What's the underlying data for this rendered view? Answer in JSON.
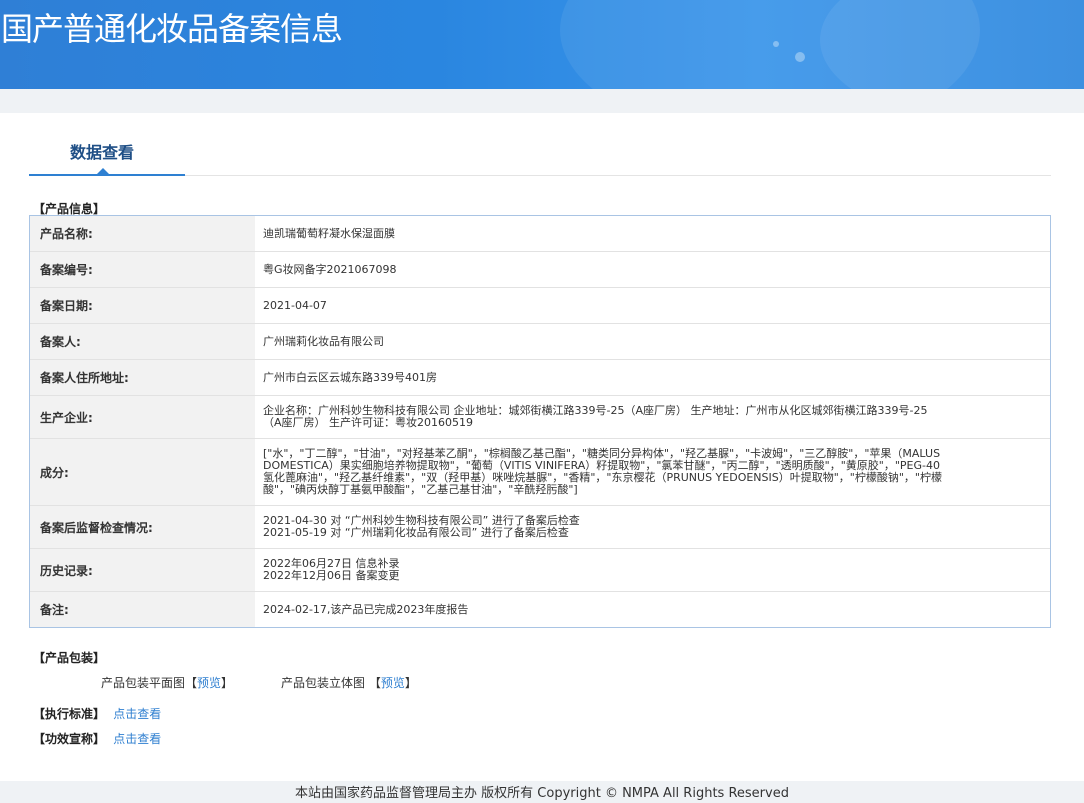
{
  "header": {
    "title": "国产普通化妆品备案信息"
  },
  "tab": {
    "label": "数据查看"
  },
  "sections": {
    "product_info": "【产品信息】",
    "product_package": "【产品包装】",
    "exec_standard": "【执行标准】",
    "efficacy_claim": "【功效宣称】"
  },
  "rows": [
    {
      "label": "产品名称:",
      "value": "迪凯瑞葡萄籽凝水保湿面膜"
    },
    {
      "label": "备案编号:",
      "value": "粤G妆网备字2021067098"
    },
    {
      "label": "备案日期:",
      "value": "2021-04-07"
    },
    {
      "label": "备案人:",
      "value": "广州瑞莉化妆品有限公司"
    },
    {
      "label": "备案人住所地址:",
      "value": "广州市白云区云城东路339号401房"
    },
    {
      "label": "生产企业:",
      "lines": [
        "企业名称：广州科妙生物科技有限公司 企业地址：城郊街横江路339号-25（A座厂房） 生产地址：广州市从化区城郊街横江路339号-25",
        "（A座厂房） 生产许可证：粤妆20160519"
      ]
    },
    {
      "label": "成分:",
      "lines": [
        "[\"水\"，\"丁二醇\"，\"甘油\"，\"对羟基苯乙酮\"，\"棕榈酸乙基己酯\"，\"糖类同分异构体\"，\"羟乙基脲\"，\"卡波姆\"，\"三乙醇胺\"，\"苹果（MALUS",
        "DOMESTICA）果实细胞培养物提取物\"，\"葡萄（VITIS VINIFERA）籽提取物\"，\"氯苯甘醚\"，\"丙二醇\"，\"透明质酸\"，\"黄原胶\"，\"PEG-40",
        "氢化蓖麻油\"，\"羟乙基纤维素\"，\"双（羟甲基）咪唑烷基脲\"，\"香精\"，\"东京樱花（PRUNUS YEDOENSIS）叶提取物\"，\"柠檬酸钠\"，\"柠檬",
        "酸\"，\"碘丙炔醇丁基氨甲酸酯\"，\"乙基己基甘油\"，\"辛酰羟肟酸\"]"
      ]
    },
    {
      "label": "备案后监督检查情况:",
      "lines": [
        "2021-04-30 对 “广州科妙生物科技有限公司” 进行了备案后检查",
        "2021-05-19 对 “广州瑞莉化妆品有限公司” 进行了备案后检查"
      ]
    },
    {
      "label": "历史记录:",
      "lines": [
        "2022年06月27日 信息补录",
        "2022年12月06日 备案变更"
      ]
    },
    {
      "label": "备注:",
      "value": "2024-02-17,该产品已完成2023年度报告"
    }
  ],
  "package": {
    "flat_label": "产品包装平面图",
    "stereo_label": "产品包装立体图",
    "bracket_open": "【",
    "bracket_close": "】",
    "preview": "预览"
  },
  "links": {
    "view": "点击查看"
  },
  "footer": {
    "text": "本站由国家药品监督管理局主办 版权所有 Copyright © NMPA All Rights Reserved"
  },
  "colors": {
    "header": "#2a86e0",
    "link": "#2f7fd0",
    "tab": "#1f4f86",
    "border": "#a9c4e4"
  }
}
